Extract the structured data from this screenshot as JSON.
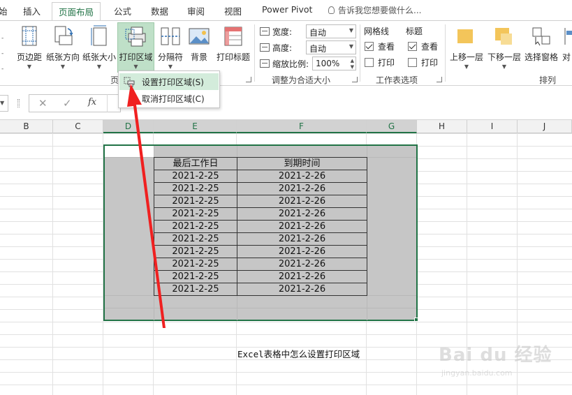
{
  "tabs": {
    "cut_first": "始",
    "insert": "插入",
    "page_layout": "页面布局",
    "formulas": "公式",
    "data": "数据",
    "review": "审阅",
    "view": "视图",
    "power_pivot": "Power Pivot",
    "tell_me": "告诉我您想要做什么..."
  },
  "ribbon": {
    "page_setup": {
      "margins": "页边距",
      "orientation": "纸张方向",
      "size": "纸张大小",
      "print_area": "打印区域",
      "breaks": "分隔符",
      "background": "背景",
      "print_titles": "打印标题",
      "group_label_cut": "页"
    },
    "scale_to_fit": {
      "width_label": "宽度:",
      "width_value": "自动",
      "height_label": "高度:",
      "height_value": "自动",
      "scale_label": "缩放比例:",
      "scale_value": "100%",
      "group_label": "调整为合适大小"
    },
    "sheet_options": {
      "gridlines_title": "网格线",
      "headings_title": "标题",
      "view_label": "查看",
      "print_label": "打印",
      "gridlines_view_checked": true,
      "gridlines_print_checked": false,
      "headings_view_checked": true,
      "headings_print_checked": false,
      "group_label": "工作表选项"
    },
    "arrange": {
      "bring_forward": "上移一层",
      "send_backward": "下移一层",
      "selection_pane": "选择窗格",
      "align_cut": "对",
      "group_label": "排列"
    }
  },
  "print_area_menu": {
    "set": "设置打印区域(S)",
    "clear": "取消打印区域(C)"
  },
  "formula_bar": {
    "cancel": "✕",
    "enter": "✓",
    "fx": "fx"
  },
  "columns": [
    "B",
    "C",
    "D",
    "E",
    "F",
    "G",
    "H",
    "I",
    "J"
  ],
  "sheet": {
    "header_workday": "最后工作日",
    "header_due": "到期时间",
    "rows": [
      [
        "2021-2-25",
        "2021-2-26"
      ],
      [
        "2021-2-25",
        "2021-2-26"
      ],
      [
        "2021-2-25",
        "2021-2-26"
      ],
      [
        "2021-2-25",
        "2021-2-26"
      ],
      [
        "2021-2-25",
        "2021-2-26"
      ],
      [
        "2021-2-25",
        "2021-2-26"
      ],
      [
        "2021-2-25",
        "2021-2-26"
      ],
      [
        "2021-2-25",
        "2021-2-26"
      ],
      [
        "2021-2-25",
        "2021-2-26"
      ],
      [
        "2021-2-25",
        "2021-2-26"
      ]
    ],
    "caption": "Excel表格中怎么设置打印区域"
  },
  "watermark": {
    "text": "Bai du 经验",
    "sub": "jingyan.baidu.com"
  },
  "colors": {
    "accent_green": "#217346",
    "selection_fill": "#c6c6c6",
    "arrow_red": "#f02020"
  }
}
